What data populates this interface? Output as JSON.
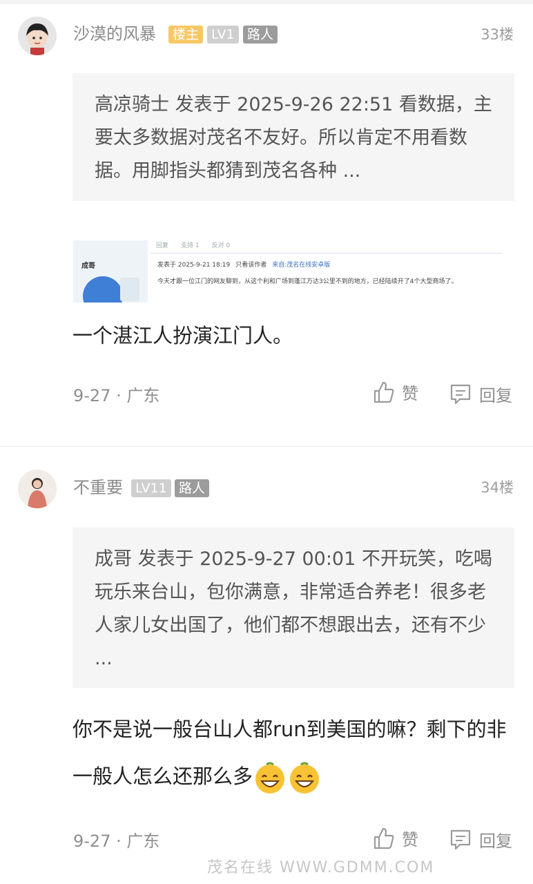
{
  "posts": [
    {
      "username": "沙漠的风暴",
      "badges": [
        "楼主",
        "LV1",
        "路人"
      ],
      "floor": "33楼",
      "quote": "高凉骑士 发表于 2025-9-26 22:51 看数据，主要太多数据对茂名不友好。所以肯定不用看数据。用脚指头都猜到茂名各种 ...",
      "content": "一个湛江人扮演江门人。",
      "meta": "9-27 · 广东",
      "like_label": "赞",
      "reply_label": "回复"
    },
    {
      "username": "不重要",
      "badges": [
        "LV11",
        "路人"
      ],
      "floor": "34楼",
      "quote": "成哥 发表于 2025-9-27 00:01 不开玩笑，吃喝玩乐来台山，包你满意，非常适合养老！很多老人家儿女出国了，他们都不想跟出去，还有不少 ...",
      "content": "你不是说一般台山人都run到美国的嘛？剩下的非一般人怎么还那么多",
      "meta": "9-27 · 广东",
      "like_label": "赞",
      "reply_label": "回复"
    }
  ],
  "embedded_image": {
    "toolbar": [
      "回复",
      "支持 1",
      "反对 0"
    ],
    "author": "成哥",
    "posted": "发表于 2025-9-21 18:19",
    "only_author": "只看该作者",
    "source": "来自:茂名在线安卓版",
    "text": "今天才跟一位江门的网友聊到，从这个利和广场到蓬江万达3公里不到的地方，已经陆续开了4个大型商场了。"
  },
  "watermark": "茂名在线 WWW.GDMM.COM"
}
